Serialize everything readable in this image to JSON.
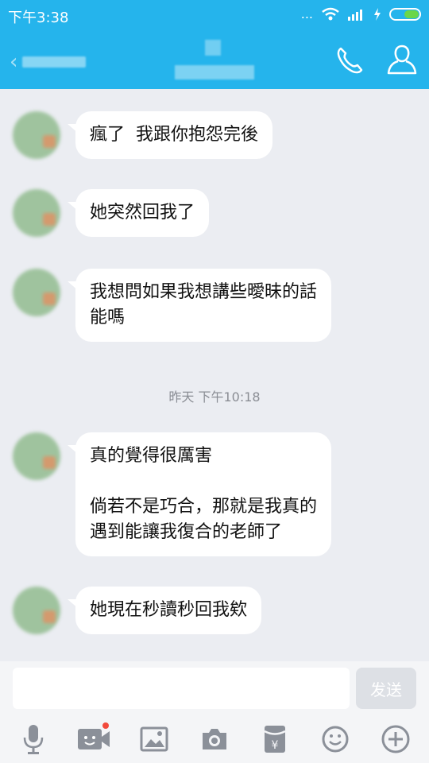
{
  "status": {
    "time": "下午3:38",
    "dots": "..."
  },
  "chat": {
    "timestamp": "昨天 下午10:18",
    "messages": [
      {
        "text": "瘋了  我跟你抱怨完後"
      },
      {
        "text": "她突然回我了"
      },
      {
        "text": "我想問如果我想講些曖昧的話\n能嗎"
      },
      {
        "text": "真的覺得很厲害\n\n倘若不是巧合，那就是我真的\n遇到能讓我復合的老師了"
      },
      {
        "text": "她現在秒讀秒回我欸"
      }
    ]
  },
  "input": {
    "value": "",
    "send_label": "发送"
  },
  "toolbar": {
    "icons": [
      "microphone-icon",
      "video-call-icon",
      "image-icon",
      "camera-icon",
      "red-packet-icon",
      "emoji-icon",
      "plus-icon"
    ]
  },
  "colors": {
    "header": "#25b4ec",
    "background": "#ebedf2",
    "bubble": "#ffffff"
  }
}
